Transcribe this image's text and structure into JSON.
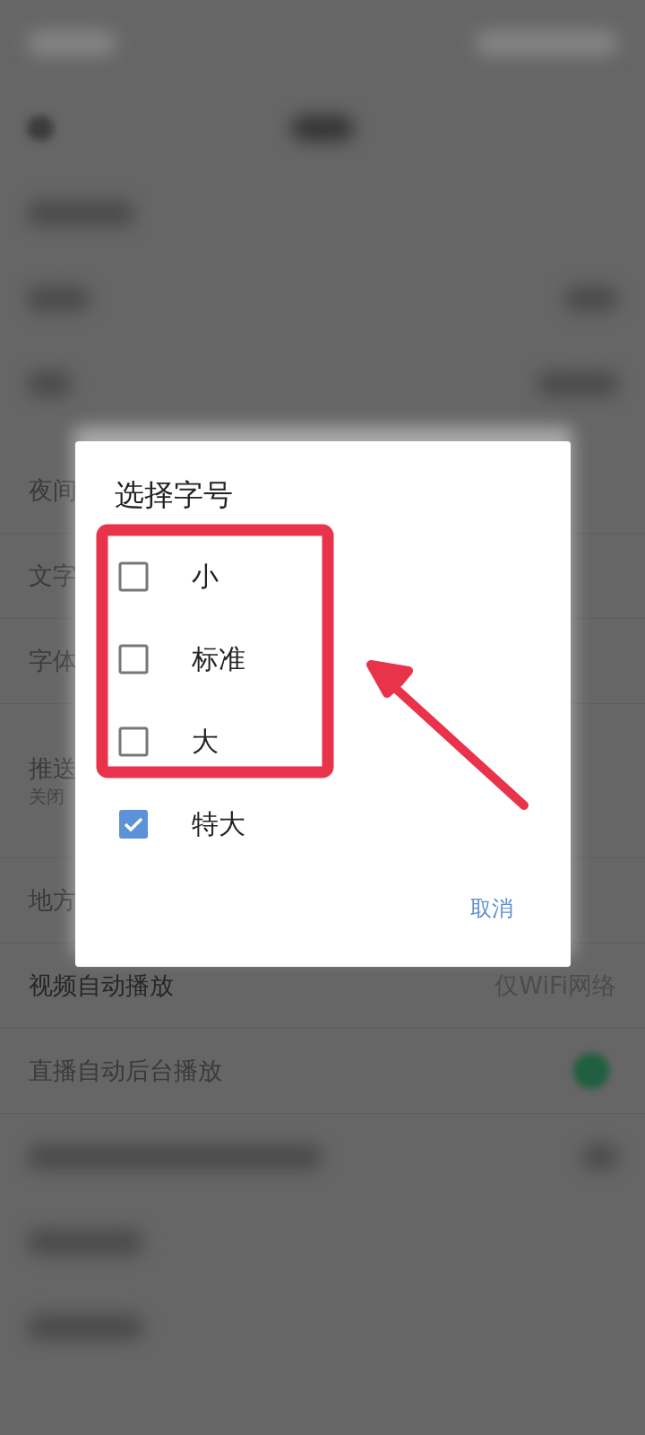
{
  "settings_rows": [
    {
      "kind": "plain",
      "label": "夜间"
    },
    {
      "kind": "plain",
      "label": "文字"
    },
    {
      "kind": "plain",
      "label": "字体"
    },
    {
      "kind": "sub",
      "label": "推送",
      "sublabel": "关闭"
    },
    {
      "kind": "plain",
      "label": "地方"
    },
    {
      "kind": "value",
      "label": "视频自动播放",
      "value": "仅WiFi网络"
    },
    {
      "kind": "toggle",
      "label": "直播自动后台播放",
      "on": true
    }
  ],
  "dialog": {
    "title": "选择字号",
    "options": [
      {
        "label": "小",
        "checked": false
      },
      {
        "label": "标准",
        "checked": false
      },
      {
        "label": "大",
        "checked": false
      },
      {
        "label": "特大",
        "checked": true
      }
    ],
    "cancel_button": "取消"
  }
}
